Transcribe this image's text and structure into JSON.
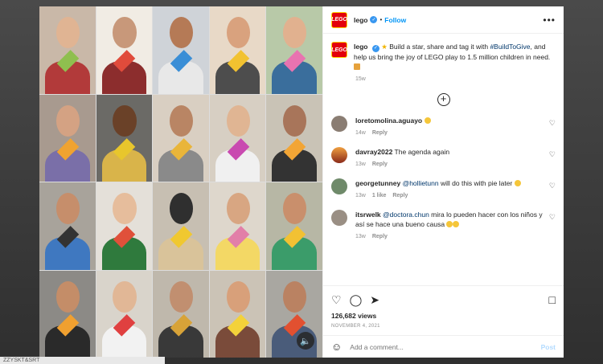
{
  "post": {
    "username": "lego",
    "follow_label": "Follow",
    "more_label": "•••",
    "caption": {
      "username": "lego",
      "text_before": "Build a star, share and tag it with ",
      "hashtag": "#BuildToGive",
      "text_after": ", and help us bring the joy of LEGO play to 1.5 million children in need.",
      "time": "15w"
    },
    "comments": [
      {
        "username": "loretomolina.aguayo",
        "text": "",
        "time": "14w",
        "likes": "",
        "reply_label": "Reply",
        "avatar_color": "#8a7d73",
        "has_emoji": true
      },
      {
        "username": "davray2022",
        "text": "The agenda again",
        "time": "13w",
        "likes": "",
        "reply_label": "Reply",
        "avatar_color": "#c4542a",
        "has_emoji": false
      },
      {
        "username": "georgetunney",
        "mention": "@hollietunn",
        "text": " will do this with pie later",
        "time": "13w",
        "likes": "1 like",
        "reply_label": "Reply",
        "avatar_color": "#6f8a6a",
        "has_emoji": true
      },
      {
        "username": "itsrwelk",
        "mention": "@doctora.chun",
        "text": " mira lo pueden hacer con los niños y así se hace una bueno causa",
        "time": "13w",
        "likes": "",
        "reply_label": "Reply",
        "avatar_color": "#9a8f84",
        "has_emoji": true
      }
    ],
    "views": "126,682 views",
    "date": "NOVEMBER 4, 2021",
    "add_comment_placeholder": "Add a comment...",
    "post_label": "Post"
  },
  "status_strip": "ZZYSKT&SRT",
  "colors": {
    "brand_red": "#e3000b",
    "link_blue": "#0095f6"
  }
}
